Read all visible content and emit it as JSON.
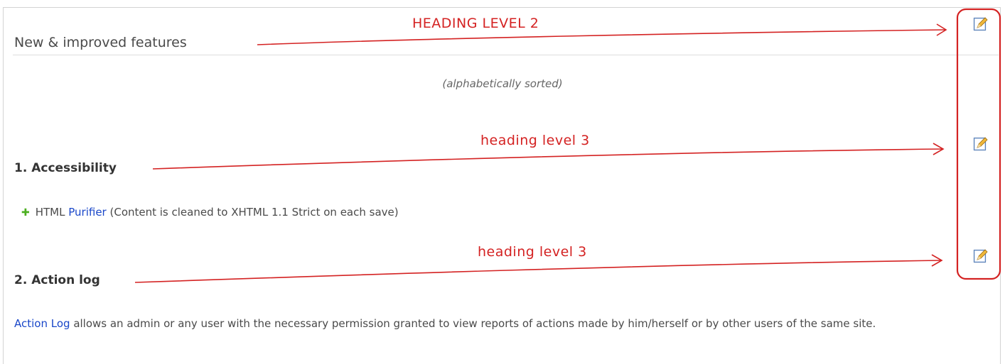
{
  "section": {
    "heading2": "New & improved features",
    "sort_note": "(alphabetically sorted)"
  },
  "items": [
    {
      "heading": "1. Accessibility"
    },
    {
      "heading": "2. Action log"
    }
  ],
  "accessibility": {
    "bullet_text_prefix": "HTML ",
    "bullet_link": "Purifier",
    "bullet_text_suffix": " (Content is cleaned to XHTML 1.1 Strict on each save)"
  },
  "action_log": {
    "link": "Action Log",
    "text": " allows an admin or any user with the necessary permission granted to view reports of actions made by him/herself or by other users of the same site."
  },
  "annotations": {
    "heading2": "HEADING LEVEL 2",
    "heading3_a": "heading level 3",
    "heading3_b": "heading level 3"
  },
  "icons": {
    "edit": "edit-pencil-icon",
    "bullet": "plus-icon"
  },
  "colors": {
    "link": "#1a47c9",
    "annotation": "#d42222",
    "bullet": "#4caf20"
  }
}
